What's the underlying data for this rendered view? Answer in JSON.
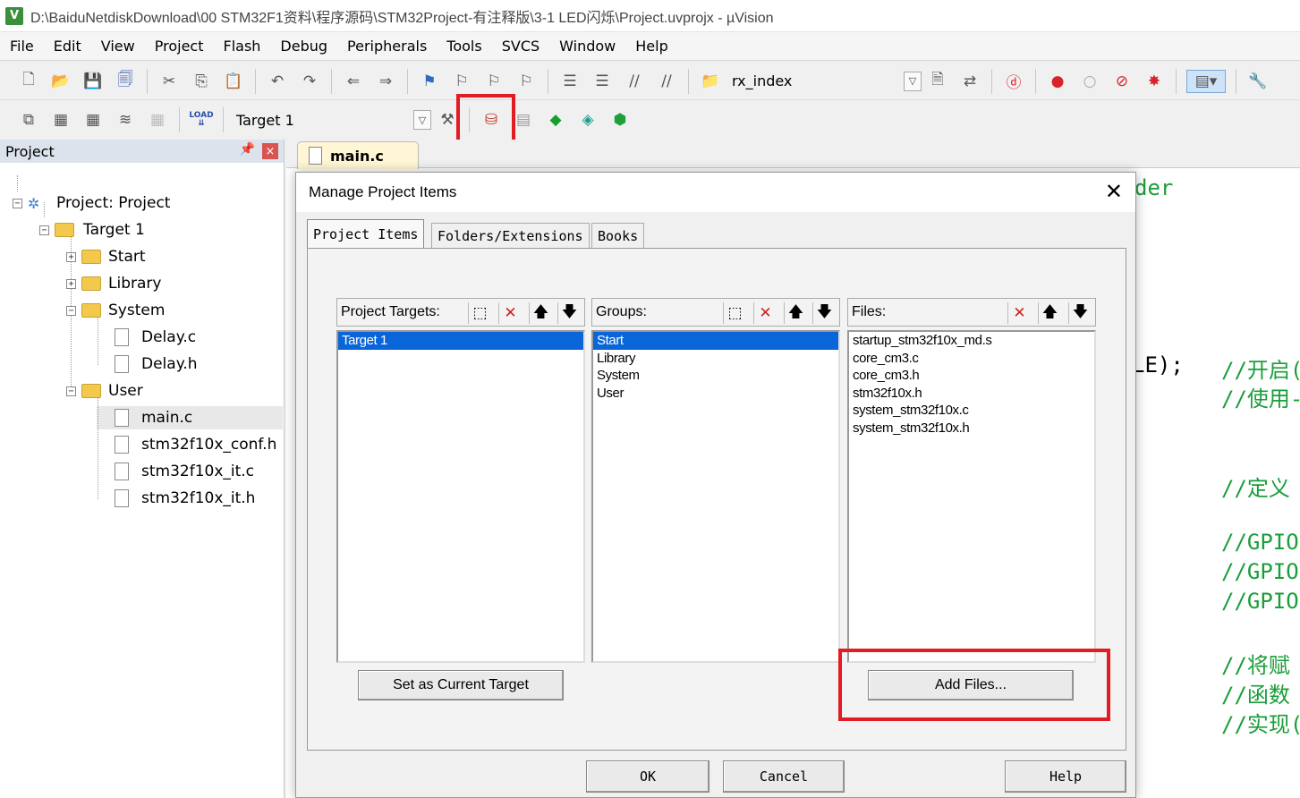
{
  "window": {
    "title": "D:\\BaiduNetdiskDownload\\00 STM32F1资料\\程序源码\\STM32Project-有注释版\\3-1 LED闪烁\\Project.uvprojx - µVision",
    "app_icon": "V"
  },
  "menu": [
    "File",
    "Edit",
    "View",
    "Project",
    "Flash",
    "Debug",
    "Peripherals",
    "Tools",
    "SVCS",
    "Window",
    "Help"
  ],
  "toolbar": {
    "find_combo": "rx_index",
    "target_combo": "Target 1",
    "load_label": "LOAD"
  },
  "project_panel": {
    "title": "Project",
    "root": "Project: Project",
    "target": "Target 1",
    "groups": [
      "Start",
      "Library",
      "System",
      "User"
    ],
    "system_files": [
      "Delay.c",
      "Delay.h"
    ],
    "user_files": [
      "main.c",
      "stm32f10x_conf.h",
      "stm32f10x_it.c",
      "stm32f10x_it.h"
    ]
  },
  "editor": {
    "tab": "main.c",
    "code_fragments": [
      "der",
      "LE);",
      "//开启(",
      "//使用-",
      "//定义",
      "//GPIO",
      "//GPIO",
      "//GPIO",
      "//将赋",
      "//函数",
      "//实现("
    ]
  },
  "dialog": {
    "title": "Manage Project Items",
    "tabs": [
      "Project Items",
      "Folders/Extensions",
      "Books"
    ],
    "targets_label": "Project Targets:",
    "groups_label": "Groups:",
    "files_label": "Files:",
    "targets": [
      "Target 1"
    ],
    "groups": [
      "Start",
      "Library",
      "System",
      "User"
    ],
    "files": [
      "startup_stm32f10x_md.s",
      "core_cm3.c",
      "core_cm3.h",
      "stm32f10x.h",
      "system_stm32f10x.c",
      "system_stm32f10x.h"
    ],
    "set_target_button": "Set as Current Target",
    "add_files_button": "Add Files...",
    "ok_button": "OK",
    "cancel_button": "Cancel",
    "help_button": "Help"
  },
  "highlight_color": "#e31c23",
  "selection_color": "#0a66d8"
}
